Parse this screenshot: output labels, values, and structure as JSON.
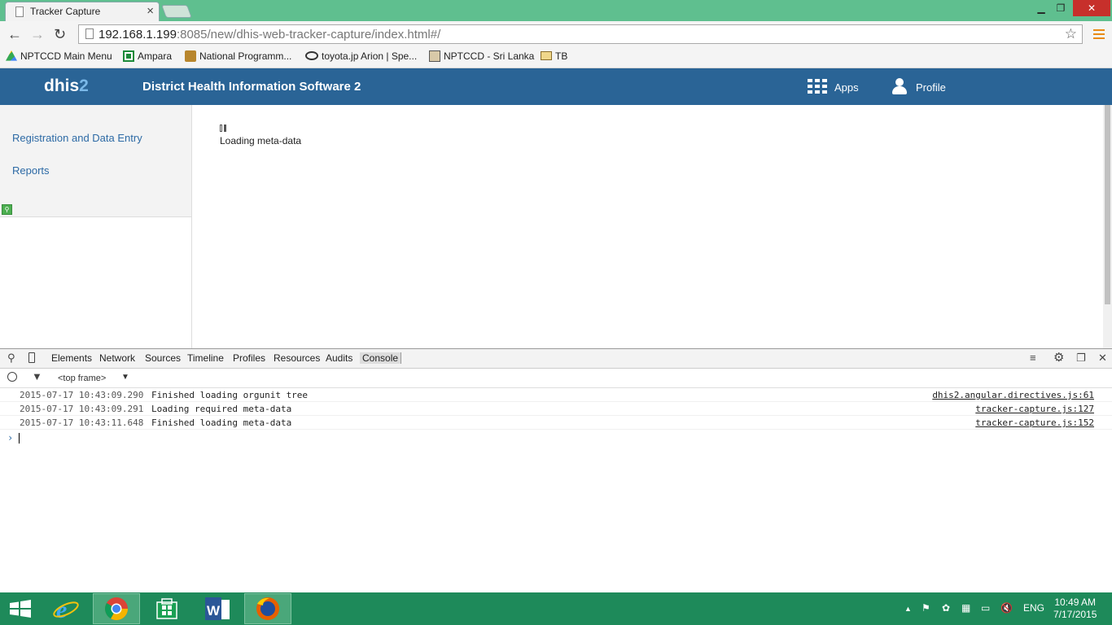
{
  "browser": {
    "tab_title": "Tracker Capture",
    "tab_close": "×",
    "url_host": "192.168.1.199",
    "url_rest": ":8085/new/dhis-web-tracker-capture/index.html#/",
    "window_min": "▁",
    "window_max": "❐",
    "window_close": "✕",
    "back": "←",
    "forward": "→",
    "reload": "↻",
    "star": "☆"
  },
  "bookmarks": [
    {
      "label": "NPTCCD Main Menu",
      "icon": "drive-icon"
    },
    {
      "label": "Ampara",
      "icon": "sheet-icon"
    },
    {
      "label": "National Programm...",
      "icon": "emblem-icon"
    },
    {
      "label": "toyota.jp Arion | Spe...",
      "icon": "toyota-icon"
    },
    {
      "label": "NPTCCD - Sri Lanka",
      "icon": "image-icon"
    },
    {
      "label": "TB",
      "icon": "folder-icon"
    }
  ],
  "header": {
    "logo_main": "dhis",
    "logo_accent": "2",
    "title": "District Health Information Software 2",
    "apps_label": "Apps",
    "profile_label": "Profile"
  },
  "sidebar": {
    "items": [
      {
        "label": "Registration and Data Entry"
      },
      {
        "label": "Reports"
      }
    ],
    "search_icon": "search-icon"
  },
  "main": {
    "loading_text": "Loading meta-data"
  },
  "devtools": {
    "tabs": [
      "Elements",
      "Network",
      "Sources",
      "Timeline",
      "Profiles",
      "Resources",
      "Audits",
      "Console"
    ],
    "active_tab": "Console",
    "frame_select": "<top frame>",
    "log": [
      {
        "time": "2015-07-17 10:43:09.290",
        "message": "Finished loading orgunit tree",
        "source": "dhis2.angular.directives.js:61"
      },
      {
        "time": "2015-07-17 10:43:09.291",
        "message": "Loading required meta-data",
        "source": "tracker-capture.js:127"
      },
      {
        "time": "2015-07-17 10:43:11.648",
        "message": "Finished loading meta-data",
        "source": "tracker-capture.js:152"
      }
    ],
    "prompt": "›"
  },
  "taskbar": {
    "language": "ENG",
    "time": "10:49 AM",
    "date": "7/17/2015",
    "apps": [
      "windows-start",
      "internet-explorer",
      "chrome",
      "store",
      "word",
      "firefox"
    ]
  },
  "colors": {
    "header_bg": "#2a6496",
    "link": "#2d6aa5",
    "taskbar_bg": "#1e8a5a",
    "titlebar_bg": "#5fbf8f"
  }
}
